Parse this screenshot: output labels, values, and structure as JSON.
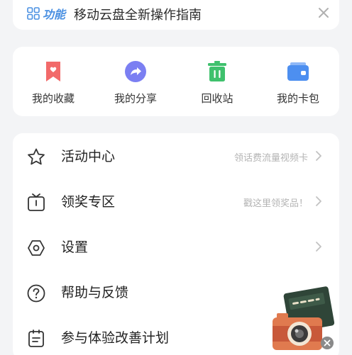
{
  "banner": {
    "tag": "功能",
    "title": "移动云盘全新操作指南",
    "icons": {
      "function": "grid-icon",
      "close": "close-icon"
    }
  },
  "shortcuts": [
    {
      "label": "我的收藏",
      "icon": "bookmark-icon",
      "color": "#f26a6a"
    },
    {
      "label": "我的分享",
      "icon": "share-icon",
      "color": "#7b7ff2"
    },
    {
      "label": "回收站",
      "icon": "trash-icon",
      "color": "#3fc16d"
    },
    {
      "label": "我的卡包",
      "icon": "wallet-icon",
      "color": "#4d8ff0"
    }
  ],
  "menu": [
    {
      "label": "活动中心",
      "hint": "领话费流量视频卡",
      "icon": "star-icon"
    },
    {
      "label": "领奖专区",
      "hint": "戳这里领奖品！",
      "icon": "gift-box-icon"
    },
    {
      "label": "设置",
      "hint": "",
      "icon": "hexagon-settings-icon"
    },
    {
      "label": "帮助与反馈",
      "hint": "",
      "icon": "help-icon"
    },
    {
      "label": "参与体验改善计划",
      "hint": "",
      "icon": "plan-icon"
    }
  ],
  "floating_ad": {
    "icon": "camera-icon"
  },
  "colors": {
    "accent": "#4a90e2",
    "background": "#f3f4f6"
  }
}
